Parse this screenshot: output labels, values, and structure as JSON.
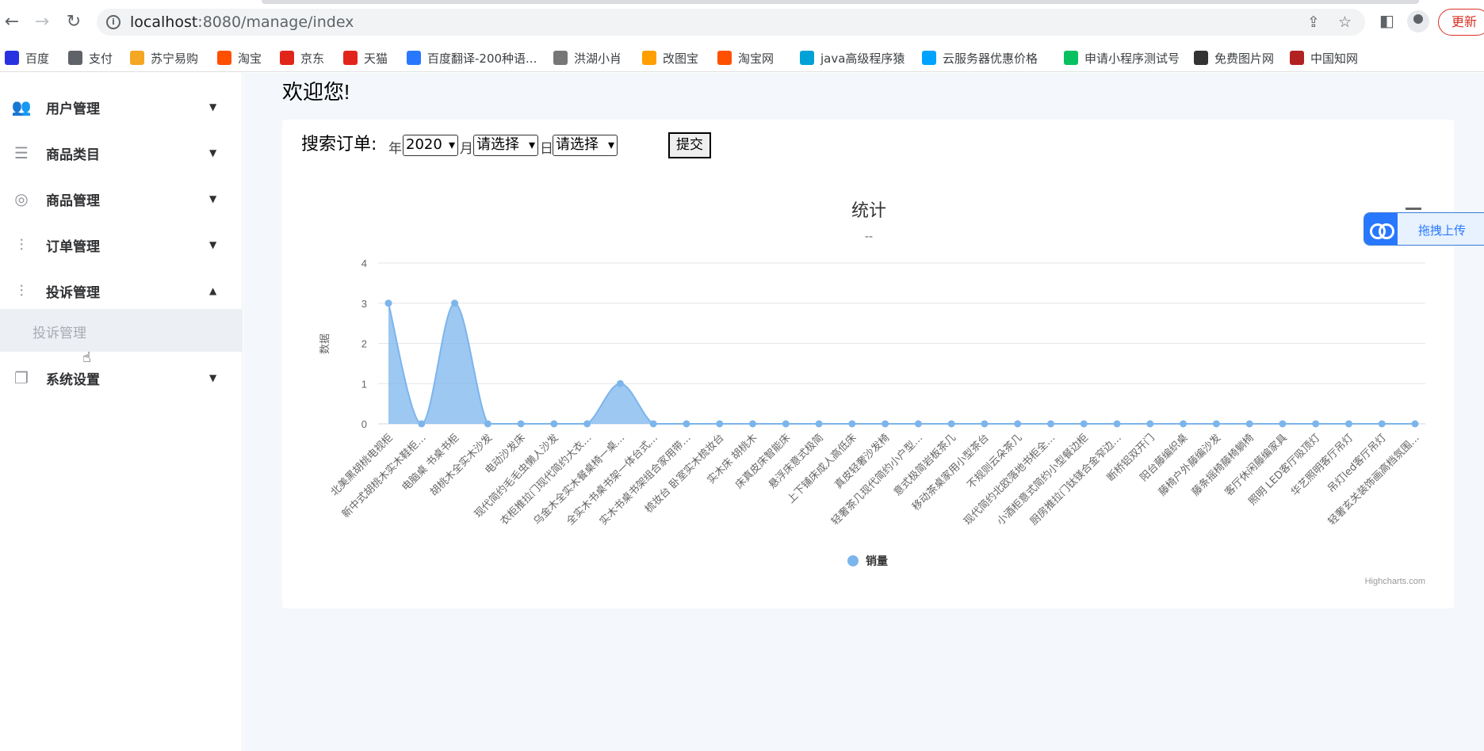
{
  "browser": {
    "url_host": "localhost",
    "url_path": ":8080/manage/index",
    "update_label": "更新"
  },
  "bookmarks": [
    {
      "label": "百度",
      "color": "#2932e1"
    },
    {
      "label": "支付",
      "color": "#5f6368"
    },
    {
      "label": "苏宁易购",
      "color": "#f5a623"
    },
    {
      "label": "淘宝",
      "color": "#ff5000"
    },
    {
      "label": "京东",
      "color": "#e1251b"
    },
    {
      "label": "天猫",
      "color": "#e1251b"
    },
    {
      "label": "百度翻译-200种语...",
      "color": "#2878ff"
    },
    {
      "label": "洪湖小肖",
      "color": "#777777"
    },
    {
      "label": "改图宝",
      "color": "#ff9f00"
    },
    {
      "label": "淘宝网",
      "color": "#ff5000"
    },
    {
      "label": "java高级程序猿",
      "color": "#00a1d6"
    },
    {
      "label": "云服务器优惠价格",
      "color": "#00a3ff"
    },
    {
      "label": "申请小程序测试号",
      "color": "#07c160"
    },
    {
      "label": "免费图片网",
      "color": "#333333"
    },
    {
      "label": "中国知网",
      "color": "#b22222"
    }
  ],
  "sidebar": {
    "items": [
      {
        "label": "用户管理",
        "icon": "users-icon",
        "chevron": "▼"
      },
      {
        "label": "商品类目",
        "icon": "list-icon",
        "chevron": "▼"
      },
      {
        "label": "商品管理",
        "icon": "aperture-icon",
        "chevron": "▼"
      },
      {
        "label": "订单管理",
        "icon": "sliders-icon",
        "chevron": "▼"
      },
      {
        "label": "投诉管理",
        "icon": "sliders-icon",
        "chevron": "▲"
      },
      {
        "label": "系统设置",
        "icon": "copy-icon",
        "chevron": "▼"
      }
    ],
    "submenu_label": "投诉管理"
  },
  "main": {
    "welcome": "欢迎您!",
    "search_label": "搜索订单:",
    "year_label": "年",
    "year_value": "2020",
    "month_label": "月",
    "month_value": "请选择",
    "day_label": "日",
    "day_value": "请选择",
    "submit_label": "提交"
  },
  "upload_widget": {
    "label": "拖拽上传"
  },
  "chart_data": {
    "type": "area",
    "title": "统计",
    "subtitle": "--",
    "ylabel": "数据",
    "ylim": [
      0,
      4
    ],
    "yticks": [
      0,
      1,
      2,
      3,
      4
    ],
    "legend": "bottom-center",
    "credit": "Highcharts.com",
    "color": "#7cb5ec",
    "categories": [
      "北美黑胡桃电视柜",
      "新中式胡桃木实木鞋柜…",
      "电脑桌 书桌书柜",
      "胡桃木全实木沙发",
      "电动沙发床",
      "现代简约毛毛虫懒人沙发",
      "衣柜推拉门现代简约大衣…",
      "乌金木全实木餐桌椅一桌…",
      "全实木书桌书架一体台式…",
      "实木书桌书架组合家用带…",
      "梳妆台 卧室实木梳妆台",
      "实木床 胡桃木",
      "床真皮床智能床",
      "悬浮床意式极简",
      "上下铺床成人高低床",
      "真皮轻奢沙发椅",
      "轻奢茶几现代简约小户型…",
      "意式极简岩板茶几",
      "移动茶桌家用小型茶台",
      "不规则云朵茶几",
      "现代简约北欧落地书柜全…",
      "小酒柜意式简约小型餐边柜",
      "厨房推拉门钛镁合金窄边…",
      "断桥铝双开门",
      "阳台藤编织桌",
      "藤椅户外藤编沙发",
      "藤条摇椅藤椅躺椅",
      "客厅休闲藤编家具",
      "照明 LED客厅吸顶灯",
      "华艺照明客厅吊灯",
      "吊灯led客厅吊灯",
      "轻奢玄关装饰画高档氛围…"
    ],
    "series": [
      {
        "name": "销量",
        "values": [
          3,
          0,
          3,
          0,
          0,
          0,
          0,
          1,
          0,
          0,
          0,
          0,
          0,
          0,
          0,
          0,
          0,
          0,
          0,
          0,
          0,
          0,
          0,
          0,
          0,
          0,
          0,
          0,
          0,
          0,
          0,
          0
        ]
      }
    ]
  }
}
